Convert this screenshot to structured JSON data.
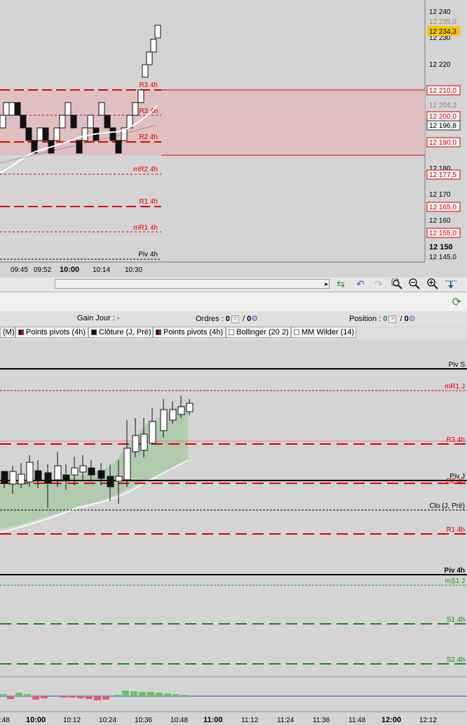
{
  "top_chart": {
    "price_ticks": [
      "12 240",
      "12 230",
      "12 220",
      "12 180",
      "12 170",
      "12 160",
      "12 150",
      "12 145,0"
    ],
    "tags": {
      "last_gray": "12 235,0",
      "current_price": "12 234,3",
      "r3": "12 210,0",
      "r3_gray": "12 204,2",
      "mr3": "12 200,0",
      "close": "12 196,8",
      "r2": "12 190,0",
      "mr2": "12 177,5",
      "r1": "12 165,0",
      "mr1": "12 155,0"
    },
    "level_labels": {
      "r3": "R3 4h",
      "mr3": "mR3 4h",
      "r2": "R2 4h",
      "mr2": "mR2 4h",
      "r1": "R1 4h",
      "mr1": "mR1 4h",
      "piv": "Piv 4h"
    },
    "time_labels": [
      "09:45",
      "09:52",
      "10:00",
      "10:14",
      "10:30"
    ],
    "colors": {
      "pivot_red": "#e00000",
      "zone_fill": "#e8b5b5",
      "current_tag": "#f7c500"
    }
  },
  "toolbar": {
    "scroll_arrow": "▸"
  },
  "info_bar": {
    "gain_label": "Gain Jour :",
    "gain_value": "-",
    "orders_label": "Ordres :",
    "orders_value_1": "0",
    "orders_sep": "/",
    "orders_value_2": "0",
    "position_label": "Position :",
    "position_value_1": "0",
    "position_sep": "/",
    "position_value_2": "0"
  },
  "legend": {
    "items": [
      "(M)",
      "Points pivots (4h)",
      "Clôture (J, Pré)",
      "Points pivots (4h)",
      "Bollinger (20 2)",
      "MM Wilder (14)"
    ]
  },
  "bottom_chart": {
    "level_labels": {
      "piv_s": "Piv S",
      "mr1_j": "mR1 J",
      "r3": "R3 4h",
      "piv_j": "Piv J",
      "r2": "R2 4h",
      "clo": "Clo (J, Pré)",
      "r1": "R1 4h",
      "piv_4h": "Piv 4h",
      "ms1_j": "mS1 J",
      "s1": "S1 4h",
      "s2": "S2 4h"
    },
    "time_labels": [
      ":48",
      "10:00",
      "10:12",
      "10:24",
      "10:36",
      "10:48",
      "11:00",
      "11:12",
      "11:24",
      "11:36",
      "11:48",
      "12:00",
      "12:12"
    ]
  }
}
